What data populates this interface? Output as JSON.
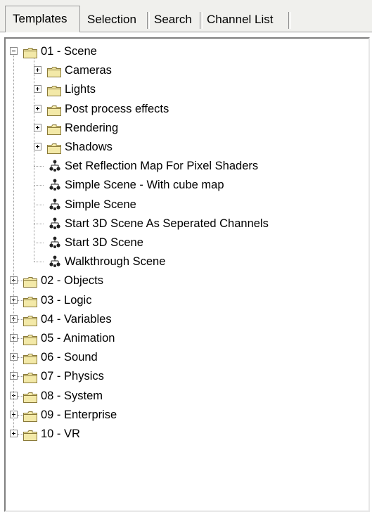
{
  "tabs": [
    {
      "label": "Templates",
      "active": true
    },
    {
      "label": "Selection",
      "active": false
    },
    {
      "label": "Search",
      "active": false
    },
    {
      "label": "Channel List",
      "active": false
    }
  ],
  "tree": {
    "root_folders": [
      {
        "label": "01 - Scene",
        "expanded": true
      },
      {
        "label": "02 - Objects",
        "expanded": false
      },
      {
        "label": "03 - Logic",
        "expanded": false
      },
      {
        "label": "04 - Variables",
        "expanded": false
      },
      {
        "label": "05 - Animation",
        "expanded": false
      },
      {
        "label": "06 - Sound",
        "expanded": false
      },
      {
        "label": "07 - Physics",
        "expanded": false
      },
      {
        "label": "08 - System",
        "expanded": false
      },
      {
        "label": "09 - Enterprise",
        "expanded": false
      },
      {
        "label": "10 - VR",
        "expanded": false
      }
    ],
    "scene_subfolders": [
      {
        "label": "Cameras"
      },
      {
        "label": "Lights"
      },
      {
        "label": "Post process effects"
      },
      {
        "label": "Rendering"
      },
      {
        "label": "Shadows"
      }
    ],
    "scene_templates": [
      {
        "label": "Set Reflection Map For Pixel Shaders"
      },
      {
        "label": "Simple Scene - With cube map"
      },
      {
        "label": "Simple Scene"
      },
      {
        "label": "Start 3D Scene As Seperated Channels"
      },
      {
        "label": "Start 3D Scene"
      },
      {
        "label": "Walkthrough Scene"
      }
    ]
  },
  "colors": {
    "folder_fill": "#f3e9a8",
    "folder_edge": "#8a7a3a",
    "template_icon": "#222222"
  },
  "icons": {
    "folder": "folder-icon",
    "template": "template-icon",
    "expand": "plus-icon",
    "collapse": "minus-icon"
  }
}
